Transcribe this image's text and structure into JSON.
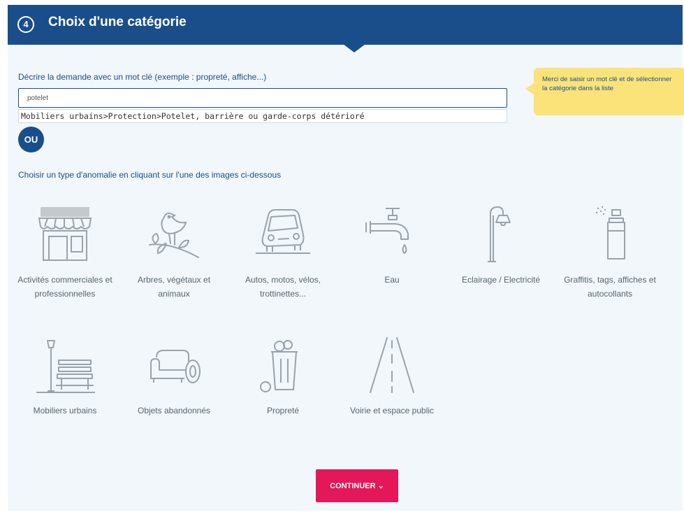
{
  "header": {
    "step_number": "4",
    "title": "Choix d'une catégorie"
  },
  "search": {
    "label": "Décrire la demande avec un mot clé (exemple : propreté, affiche...)",
    "value": "potelet",
    "suggestion": "Mobiliers urbains>Protection>Potelet, barrière ou garde-corps détérioré"
  },
  "tooltip": {
    "text": "Merci de saisir un mot clé et de sélectionner la catégorie dans la liste"
  },
  "or_label": "OU",
  "choose_label": "Choisir un type d'anomalie en cliquant sur l'une des images ci-dessous",
  "categories": [
    {
      "label": "Activités commerciales et professionnelles",
      "icon": "storefront-icon"
    },
    {
      "label": "Arbres, végétaux et animaux",
      "icon": "bird-on-branch-icon"
    },
    {
      "label": "Autos, motos, vélos, trottinettes...",
      "icon": "car-icon"
    },
    {
      "label": "Eau",
      "icon": "faucet-icon"
    },
    {
      "label": "Eclairage / Electricité",
      "icon": "street-lamp-icon"
    },
    {
      "label": "Graffitis, tags, affiches et autocollants",
      "icon": "spray-can-icon"
    },
    {
      "label": "Mobiliers urbains",
      "icon": "bench-icon"
    },
    {
      "label": "Objets abandonnés",
      "icon": "sofa-tire-icon"
    },
    {
      "label": "Propreté",
      "icon": "trash-bin-icon"
    },
    {
      "label": "Voirie et espace public",
      "icon": "road-icon"
    }
  ],
  "continue_label": "CONTINUER ⌄",
  "colors": {
    "brand_blue": "#1a4e8a",
    "accent_pink": "#e3175a",
    "tooltip_yellow": "#fbe37a",
    "icon_gray": "#9aa3ab"
  }
}
